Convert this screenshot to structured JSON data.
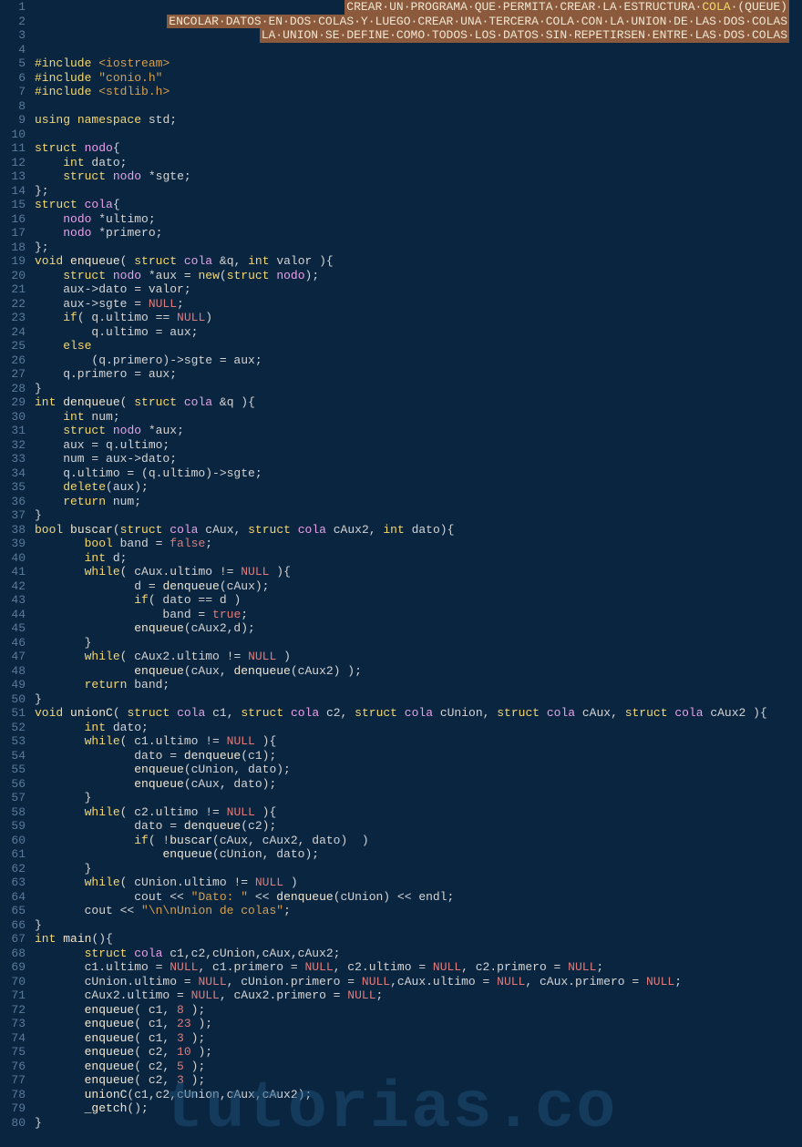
{
  "watermark": "tutorias.co",
  "lines": [
    {
      "n": 1,
      "html": "<span class='hl-line'>CREAR·UN·PROGRAMA·QUE·PERMITA·CREAR·LA·ESTRUCTURA·<span class='hl-yellow'>COLA</span>·(QUEUE)</span>",
      "align": "right"
    },
    {
      "n": 2,
      "html": "<span class='hl-line'>ENCOLAR·DATOS·EN·DOS·COLAS·Y·LUEGO·CREAR·UNA·TERCERA·COLA·CON·LA·UNION·DE·LAS·DOS·COLAS</span>",
      "align": "right"
    },
    {
      "n": 3,
      "html": "<span class='hl-line'>LA·UNION·SE·DEFINE·COMO·TODOS·LOS·DATOS·SIN·REPETIRSEN·ENTRE·LAS·DOS·COLAS</span>",
      "align": "right"
    },
    {
      "n": 4,
      "html": ""
    },
    {
      "n": 5,
      "html": "<span class='pp'>#include</span> <span class='include'>&lt;iostream&gt;</span>"
    },
    {
      "n": 6,
      "html": "<span class='pp'>#include</span> <span class='include'>\"conio.h\"</span>"
    },
    {
      "n": 7,
      "html": "<span class='pp'>#include</span> <span class='include'>&lt;stdlib.h&gt;</span>"
    },
    {
      "n": 8,
      "html": ""
    },
    {
      "n": 9,
      "html": "<span class='kw'>using</span> <span class='kw'>namespace</span> std;"
    },
    {
      "n": 10,
      "html": ""
    },
    {
      "n": 11,
      "html": "<span class='kw'>struct</span> <span class='type'>nodo</span>{"
    },
    {
      "n": 12,
      "html": "    <span class='kw'>int</span> dato;"
    },
    {
      "n": 13,
      "html": "    <span class='kw'>struct</span> <span class='type'>nodo</span> *sgte;"
    },
    {
      "n": 14,
      "html": "};"
    },
    {
      "n": 15,
      "html": "<span class='kw'>struct</span> <span class='type'>cola</span>{"
    },
    {
      "n": 16,
      "html": "    <span class='type'>nodo</span> *ultimo;"
    },
    {
      "n": 17,
      "html": "    <span class='type'>nodo</span> *primero;"
    },
    {
      "n": 18,
      "html": "};"
    },
    {
      "n": 19,
      "html": "<span class='kw'>void</span> <span class='func'>enqueue</span>( <span class='kw'>struct</span> <span class='type'>cola</span> &amp;q, <span class='kw'>int</span> valor ){"
    },
    {
      "n": 20,
      "html": "    <span class='kw'>struct</span> <span class='type'>nodo</span> *aux = <span class='kw'>new</span>(<span class='kw'>struct</span> <span class='type'>nodo</span>);"
    },
    {
      "n": 21,
      "html": "    aux-&gt;dato = valor;"
    },
    {
      "n": 22,
      "html": "    aux-&gt;sgte = <span class='const'>NULL</span>;"
    },
    {
      "n": 23,
      "html": "    <span class='kw'>if</span>( q.ultimo == <span class='const'>NULL</span>)"
    },
    {
      "n": 24,
      "html": "        q.ultimo = aux;"
    },
    {
      "n": 25,
      "html": "    <span class='kw'>else</span>"
    },
    {
      "n": 26,
      "html": "        (q.primero)-&gt;sgte = aux;"
    },
    {
      "n": 27,
      "html": "    q.primero = aux;"
    },
    {
      "n": 28,
      "html": "}"
    },
    {
      "n": 29,
      "html": "<span class='kw'>int</span> <span class='func'>denqueue</span>( <span class='kw'>struct</span> <span class='type'>cola</span> &amp;q ){"
    },
    {
      "n": 30,
      "html": "    <span class='kw'>int</span> num;"
    },
    {
      "n": 31,
      "html": "    <span class='kw'>struct</span> <span class='type'>nodo</span> *aux;"
    },
    {
      "n": 32,
      "html": "    aux = q.ultimo;"
    },
    {
      "n": 33,
      "html": "    num = aux-&gt;dato;"
    },
    {
      "n": 34,
      "html": "    q.ultimo = (q.ultimo)-&gt;sgte;"
    },
    {
      "n": 35,
      "html": "    <span class='kw'>delete</span>(aux);"
    },
    {
      "n": 36,
      "html": "    <span class='kw'>return</span> num;"
    },
    {
      "n": 37,
      "html": "}"
    },
    {
      "n": 38,
      "html": "<span class='kw'>bool</span> <span class='func'>buscar</span>(<span class='kw'>struct</span> <span class='type'>cola</span> cAux, <span class='kw'>struct</span> <span class='type'>cola</span> cAux2, <span class='kw'>int</span> dato){"
    },
    {
      "n": 39,
      "html": "       <span class='kw'>bool</span> band = <span class='const'>false</span>;"
    },
    {
      "n": 40,
      "html": "       <span class='kw'>int</span> d;"
    },
    {
      "n": 41,
      "html": "       <span class='kw'>while</span>( cAux.ultimo != <span class='const'>NULL</span> ){"
    },
    {
      "n": 42,
      "html": "              d = <span class='func'>denqueue</span>(cAux);"
    },
    {
      "n": 43,
      "html": "              <span class='kw'>if</span>( dato == d )"
    },
    {
      "n": 44,
      "html": "                  band = <span class='const'>true</span>;"
    },
    {
      "n": 45,
      "html": "              <span class='func'>enqueue</span>(cAux2,d);"
    },
    {
      "n": 46,
      "html": "       }"
    },
    {
      "n": 47,
      "html": "       <span class='kw'>while</span>( cAux2.ultimo != <span class='const'>NULL</span> )"
    },
    {
      "n": 48,
      "html": "              <span class='func'>enqueue</span>(cAux, <span class='func'>denqueue</span>(cAux2) );"
    },
    {
      "n": 49,
      "html": "       <span class='kw'>return</span> band;"
    },
    {
      "n": 50,
      "html": "}"
    },
    {
      "n": 51,
      "html": "<span class='kw'>void</span> <span class='func'>unionC</span>( <span class='kw'>struct</span> <span class='type'>cola</span> c1, <span class='kw'>struct</span> <span class='type'>cola</span> c2, <span class='kw'>struct</span> <span class='type'>cola</span> cUnion, <span class='kw'>struct</span> <span class='type'>cola</span> cAux, <span class='kw'>struct</span> <span class='type'>cola</span> cAux2 ){"
    },
    {
      "n": 52,
      "html": "       <span class='kw'>int</span> dato;"
    },
    {
      "n": 53,
      "html": "       <span class='kw'>while</span>( c1.ultimo != <span class='const'>NULL</span> ){"
    },
    {
      "n": 54,
      "html": "              dato = <span class='func'>denqueue</span>(c1);"
    },
    {
      "n": 55,
      "html": "              <span class='func'>enqueue</span>(cUnion, dato);"
    },
    {
      "n": 56,
      "html": "              <span class='func'>enqueue</span>(cAux, dato);"
    },
    {
      "n": 57,
      "html": "       }"
    },
    {
      "n": 58,
      "html": "       <span class='kw'>while</span>( c2.ultimo != <span class='const'>NULL</span> ){"
    },
    {
      "n": 59,
      "html": "              dato = <span class='func'>denqueue</span>(c2);"
    },
    {
      "n": 60,
      "html": "              <span class='kw'>if</span>( !<span class='func'>buscar</span>(cAux, cAux2, dato)  )"
    },
    {
      "n": 61,
      "html": "                  <span class='func'>enqueue</span>(cUnion, dato);"
    },
    {
      "n": 62,
      "html": "       }"
    },
    {
      "n": 63,
      "html": "       <span class='kw'>while</span>( cUnion.ultimo != <span class='const'>NULL</span> )"
    },
    {
      "n": 64,
      "html": "              cout &lt;&lt; <span class='str'>\"Dato: \"</span> &lt;&lt; <span class='func'>denqueue</span>(cUnion) &lt;&lt; endl;"
    },
    {
      "n": 65,
      "html": "       cout &lt;&lt; <span class='str'>\"\\n\\nUnion de colas\"</span>;"
    },
    {
      "n": 66,
      "html": "}"
    },
    {
      "n": 67,
      "html": "<span class='kw'>int</span> <span class='func'>main</span>(){"
    },
    {
      "n": 68,
      "html": "       <span class='kw'>struct</span> <span class='type'>cola</span> c1,c2,cUnion,cAux,cAux2;"
    },
    {
      "n": 69,
      "html": "       c1.ultimo = <span class='const'>NULL</span>, c1.primero = <span class='const'>NULL</span>, c2.ultimo = <span class='const'>NULL</span>, c2.primero = <span class='const'>NULL</span>;"
    },
    {
      "n": 70,
      "html": "       cUnion.ultimo = <span class='const'>NULL</span>, cUnion.primero = <span class='const'>NULL</span>,cAux.ultimo = <span class='const'>NULL</span>, cAux.primero = <span class='const'>NULL</span>;"
    },
    {
      "n": 71,
      "html": "       cAux2.ultimo = <span class='const'>NULL</span>, cAux2.primero = <span class='const'>NULL</span>;"
    },
    {
      "n": 72,
      "html": "       <span class='func'>enqueue</span>( c1, <span class='num'>8</span> );"
    },
    {
      "n": 73,
      "html": "       <span class='func'>enqueue</span>( c1, <span class='num'>23</span> );"
    },
    {
      "n": 74,
      "html": "       <span class='func'>enqueue</span>( c1, <span class='num'>3</span> );"
    },
    {
      "n": 75,
      "html": "       <span class='func'>enqueue</span>( c2, <span class='num'>10</span> );"
    },
    {
      "n": 76,
      "html": "       <span class='func'>enqueue</span>( c2, <span class='num'>5</span> );"
    },
    {
      "n": 77,
      "html": "       <span class='func'>enqueue</span>( c2, <span class='num'>3</span> );"
    },
    {
      "n": 78,
      "html": "       <span class='func'>unionC</span>(c1,c2,cUnion,cAux,cAux2);"
    },
    {
      "n": 79,
      "html": "       <span class='func'>_getch</span>();"
    },
    {
      "n": 80,
      "html": "}"
    }
  ]
}
